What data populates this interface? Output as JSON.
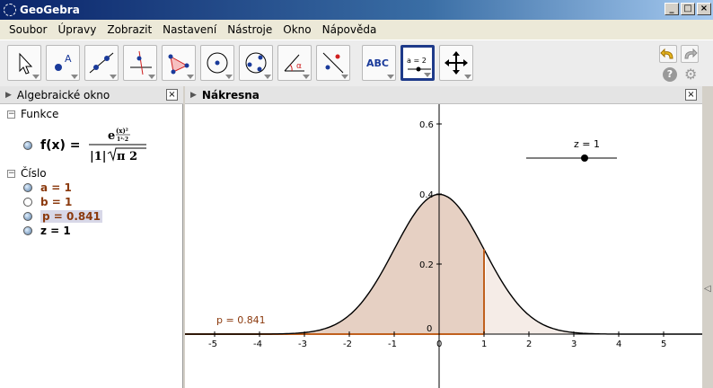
{
  "window": {
    "title": "GeoGebra"
  },
  "menu": [
    "Soubor",
    "Úpravy",
    "Zobrazit",
    "Nastavení",
    "Nástroje",
    "Okno",
    "Nápověda"
  ],
  "toolbar": {
    "tools": [
      "move-tool-icon",
      "point-tool-icon",
      "line-tool-icon",
      "perpendicular-tool-icon",
      "polygon-tool-icon",
      "circle-tool-icon",
      "conic-tool-icon",
      "angle-tool-icon",
      "reflect-tool-icon",
      "text-tool-icon",
      "slider-tool-icon",
      "move-view-tool-icon"
    ],
    "text_tool_label": "ABC",
    "slider_tool_label": "a = 2"
  },
  "algebra": {
    "title": "Algebraické okno",
    "groups": [
      {
        "label": "Funkce",
        "items": [
          {
            "label": "f(x) =",
            "shown": true
          }
        ]
      },
      {
        "label": "Číslo",
        "items": [
          {
            "label": "a = 1",
            "shown": true,
            "color": "#8b3a0e"
          },
          {
            "label": "b = 1",
            "shown": false,
            "color": "#8b3a0e"
          },
          {
            "label": "p = 0.841",
            "shown": true,
            "color": "#8b3a0e",
            "selected": true
          },
          {
            "label": "z = 1",
            "shown": true,
            "color": "#000000"
          }
        ]
      }
    ],
    "formula": {
      "num": "e",
      "exp_num": "(x)²",
      "exp_den": "1²·2",
      "den_left": "|1|",
      "den_sqrt": "π 2"
    }
  },
  "graphics": {
    "title": "Nákresna",
    "slider_label": "z = 1",
    "p_label": "p = 0.841",
    "x_ticks": [
      "-5",
      "-4",
      "-3",
      "-2",
      "-1",
      "0",
      "1",
      "2",
      "3",
      "4",
      "5"
    ],
    "y_ticks": [
      "0.6",
      "0.4",
      "0.2",
      "0"
    ],
    "colors": {
      "fill": "#c8967a",
      "curve": "#000000",
      "axis": "#000000",
      "marker": "#c0601e"
    }
  }
}
